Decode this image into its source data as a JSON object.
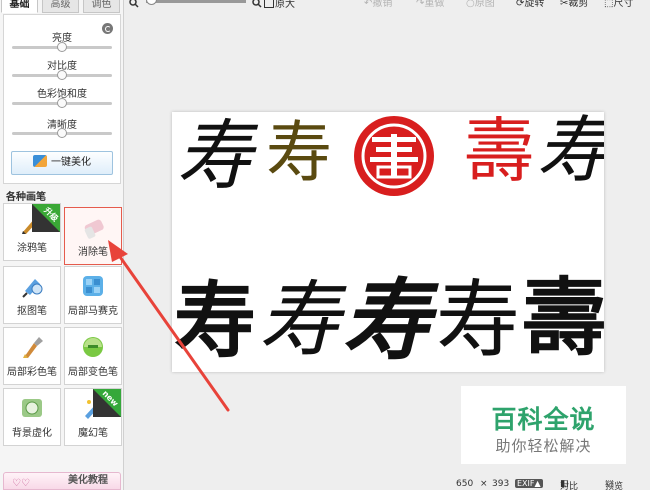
{
  "tabs": [
    "基础",
    "高级",
    "调色"
  ],
  "toolbar": {
    "original_size": "原大",
    "undo": "撤销",
    "redo": "重做",
    "original": "原图",
    "rotate": "旋转",
    "crop": "裁剪",
    "size": "尺寸"
  },
  "adjust": {
    "brightness": "亮度",
    "contrast": "对比度",
    "saturation": "色彩饱和度",
    "sharpness": "清晰度",
    "auto_beautify": "一键美化"
  },
  "brushes": {
    "title": "各种画笔",
    "items": [
      {
        "label": "涂鸦笔",
        "icon": "paintbrush-icon",
        "badge": "升级",
        "badge_color": "#3aa836"
      },
      {
        "label": "消除笔",
        "icon": "eraser-icon",
        "selected": true
      },
      {
        "label": "抠图笔",
        "icon": "cutout-pen-icon"
      },
      {
        "label": "局部马赛克",
        "icon": "mosaic-icon"
      },
      {
        "label": "局部彩色笔",
        "icon": "color-brush-icon"
      },
      {
        "label": "局部变色笔",
        "icon": "color-change-icon"
      },
      {
        "label": "背景虚化",
        "icon": "background-blur-icon"
      },
      {
        "label": "魔幻笔",
        "icon": "magic-pen-icon",
        "badge": "new",
        "badge_color": "#35a83a"
      }
    ]
  },
  "tutorial": "美化教程",
  "canvas": {
    "top_row": [
      "寿",
      "寿",
      "壽",
      "壽",
      "寿"
    ],
    "bottom_row": [
      "寿",
      "寿",
      "寿",
      "寿",
      "壽"
    ]
  },
  "watermark": {
    "title": "百科全说",
    "subtitle": "助你轻松解决",
    "color": "#2ea36c"
  },
  "status": {
    "width": "650",
    "x": "×",
    "height": "393",
    "exif": "EXIF▲",
    "compare": "对比",
    "preview": "预览"
  },
  "colors": {
    "arrow": "#e8433a",
    "seal_red": "#d81e1e"
  }
}
